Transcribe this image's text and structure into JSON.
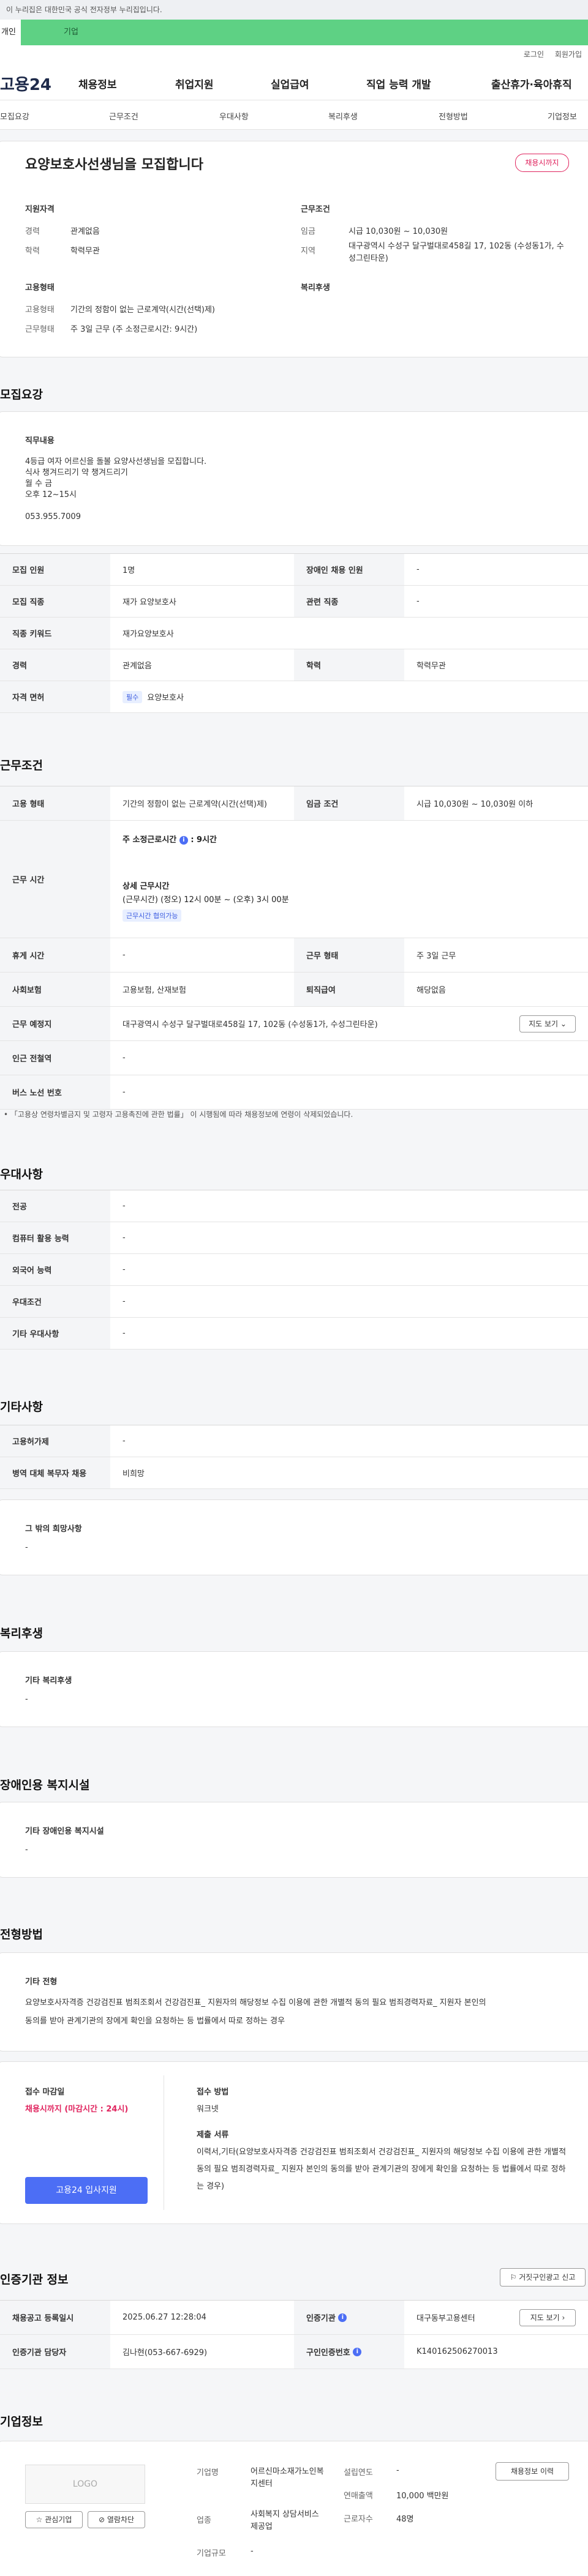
{
  "gov_banner": "이 누리집은 대한민국 공식 전자정부 누리집입니다.",
  "top_tabs": [
    "개인",
    "기업"
  ],
  "util": [
    "로그인",
    "회원가입"
  ],
  "logo": "고용24",
  "main_nav": [
    "채용정보",
    "취업지원",
    "실업급여",
    "직업 능력 개발",
    "출산휴가·육아휴직"
  ],
  "sub_nav": [
    "모집요강",
    "근무조건",
    "우대사항",
    "복리후생",
    "전형방법",
    "기업정보"
  ],
  "header_card": {
    "title": "요양보호사선생님을 모집합니다",
    "status_badge": "채용시까지",
    "qual_title": "지원자격",
    "career_label": "경력",
    "career_value": "관계없음",
    "edu_label": "학력",
    "edu_value": "학력무관",
    "work_title": "근무조건",
    "wage_label": "임금",
    "wage_value": "시급 10,030원 ~ 10,030원",
    "region_label": "지역",
    "region_value": "대구광역시 수성구 달구벌대로458길 17, 102동 (수성동1가, 수성그린타운)",
    "employ_title": "고용형태",
    "employ_type_label": "고용형태",
    "employ_type_value": "기간의 정함이 없는 근로계약(시간(선택)제)",
    "work_type_label": "근무형태",
    "work_type_value": "주 3일 근무 (주 소정근로시간: 9시간)",
    "welfare_title": "복리후생"
  },
  "recruit": {
    "section_title": "모집요강",
    "duty_title": "직무내용",
    "duty_lines": [
      "4등급 여자 어르신을 돌볼 요양사선생님을 모집합니다.",
      "식사 챙겨드리기 약 챙겨드리기",
      "월 수 금",
      "오후 12~15시"
    ],
    "phone": "053.955.7009",
    "rows": [
      {
        "k1": "모집 인원",
        "v1": "1명",
        "k2": "장애인 채용 인원",
        "v2": "-"
      },
      {
        "k1": "모집 직종",
        "v1": "재가 요양보호사",
        "k2": "관련 직종",
        "v2": "-"
      },
      {
        "k1": "직종 키워드",
        "v1": "재가요양보호사",
        "k2": "",
        "v2": ""
      },
      {
        "k1": "경력",
        "v1": "관계없음",
        "k2": "학력",
        "v2": "학력무관"
      }
    ],
    "license_label": "자격 면허",
    "license_tag": "필수",
    "license_value": "요양보호사"
  },
  "conditions": {
    "section_title": "근무조건",
    "employ_label": "고용 형태",
    "employ_value": "기간의 정함이 없는 근로계약(시간(선택)제)",
    "wage_label": "임금 조건",
    "wage_value": "시급 10,030원 ~ 10,030원 이하",
    "hours_label": "근무 시간",
    "weekly_hours": "주 소정근로시간",
    "weekly_value": ": 9시간",
    "detail_title": "상세 근무시간",
    "detail_value": "(근무시간) (정오) 12시 00분 ~ (오후) 3시 00분",
    "flex_tag": "근무시간 협의가능",
    "rest_label": "휴게 시간",
    "rest_value": "-",
    "work_form_label": "근무 형태",
    "work_form_value": "주 3일 근무",
    "insurance_label": "사회보험",
    "insurance_value": "고용보험, 산재보험",
    "severance_label": "퇴직급여",
    "severance_value": "해당없음",
    "place_label": "근무 예정지",
    "place_value": "대구광역시 수성구 달구벌대로458길 17, 102동 (수성동1가, 수성그린타운)",
    "map_button": "지도 보기",
    "station_label": "인근 전철역",
    "station_value": "-",
    "bus_label": "버스 노선 번호",
    "bus_value": "-",
    "note": "「고용상 연령차별금지 및 고령자 고용촉진에 관한 법률」 이 시행됨에 따라 채용정보에 연령이 삭제되었습니다."
  },
  "preference": {
    "section_title": "우대사항",
    "rows": [
      {
        "k": "전공",
        "v": "-"
      },
      {
        "k": "컴퓨터 활용 능력",
        "v": "-"
      },
      {
        "k": "외국어 능력",
        "v": "-"
      },
      {
        "k": "우대조건",
        "v": "-"
      },
      {
        "k": "기타 우대사항",
        "v": "-"
      }
    ]
  },
  "etc": {
    "section_title": "기타사항",
    "rows": [
      {
        "k": "고용허가제",
        "v": "-"
      },
      {
        "k": "병역 대체 복무자 채용",
        "v": "비희망"
      }
    ],
    "other_title": "그 밖의 희망사항",
    "other_value": "-"
  },
  "welfare": {
    "section_title": "복리후생",
    "box_title": "기타 복리후생",
    "box_value": "-"
  },
  "disability": {
    "section_title": "장애인용 복지시설",
    "box_title": "기타 장애인용 복지시설",
    "box_value": "-"
  },
  "screening": {
    "section_title": "전형방법",
    "box_title": "기타 전형",
    "box_lines": [
      "요양보호사자격증 건강검진표 범죄조회서 건강검진표_ 지원자의 해당정보 수집 이용에 관한 개별적 동의 필요 범죄경력자료_ 지원자 본인의",
      "동의를 받아 관계기관의 장에게 확인을 요청하는 등 법률에서 따로 정하는 경우"
    ],
    "deadline_title": "접수 마감일",
    "deadline_value": "채용시까지 (마감시간 : 24시)",
    "apply_button": "고용24 입사지원",
    "method_title": "접수 방법",
    "method_value": "워크넷",
    "docs_title": "제출 서류",
    "docs_lines": [
      "이력서,기타(요양보호사자격증 건강검진표 범죄조회서 건강검진표_ 지원자의 해당정보 수집 이용에 관한 개별적 동의 필요 범죄경력자료_ 지원자 본인의 동의를 받아 관계기관의 장에게 확인을 요청하는 등 법률에서 따로 정하는 경우)"
    ]
  },
  "agency": {
    "section_title": "인증기관 정보",
    "report_button": "거짓구인광고 신고",
    "rows": [
      {
        "k1": "채용공고 등록일시",
        "v1": "2025.06.27 12:28:04",
        "k2": "인증기관",
        "v2": "대구동부고용센터"
      },
      {
        "k1": "인증기관 담당자",
        "v1": "김나현(053-667-6929)",
        "k2": "구인인증번호",
        "v2": "K140162506270013"
      }
    ],
    "map_button": "지도 보기"
  },
  "company": {
    "section_title": "기업정보",
    "logo_text": "LOGO",
    "fav_button": "관심기업",
    "block_button": "열람차단",
    "name_label": "기업명",
    "name_value": "어르신마소재가노인복지센터",
    "industry_label": "업종",
    "industry_value": "사회복지 상담서비스 제공업",
    "scale_label": "기업규모",
    "scale_value": "-",
    "founded_label": "설립연도",
    "founded_value": "-",
    "sales_label": "연매출액",
    "sales_value": "10,000 백만원",
    "workers_label": "근로자수",
    "workers_value": "48명",
    "jobs_button": "채용정보 이력"
  }
}
